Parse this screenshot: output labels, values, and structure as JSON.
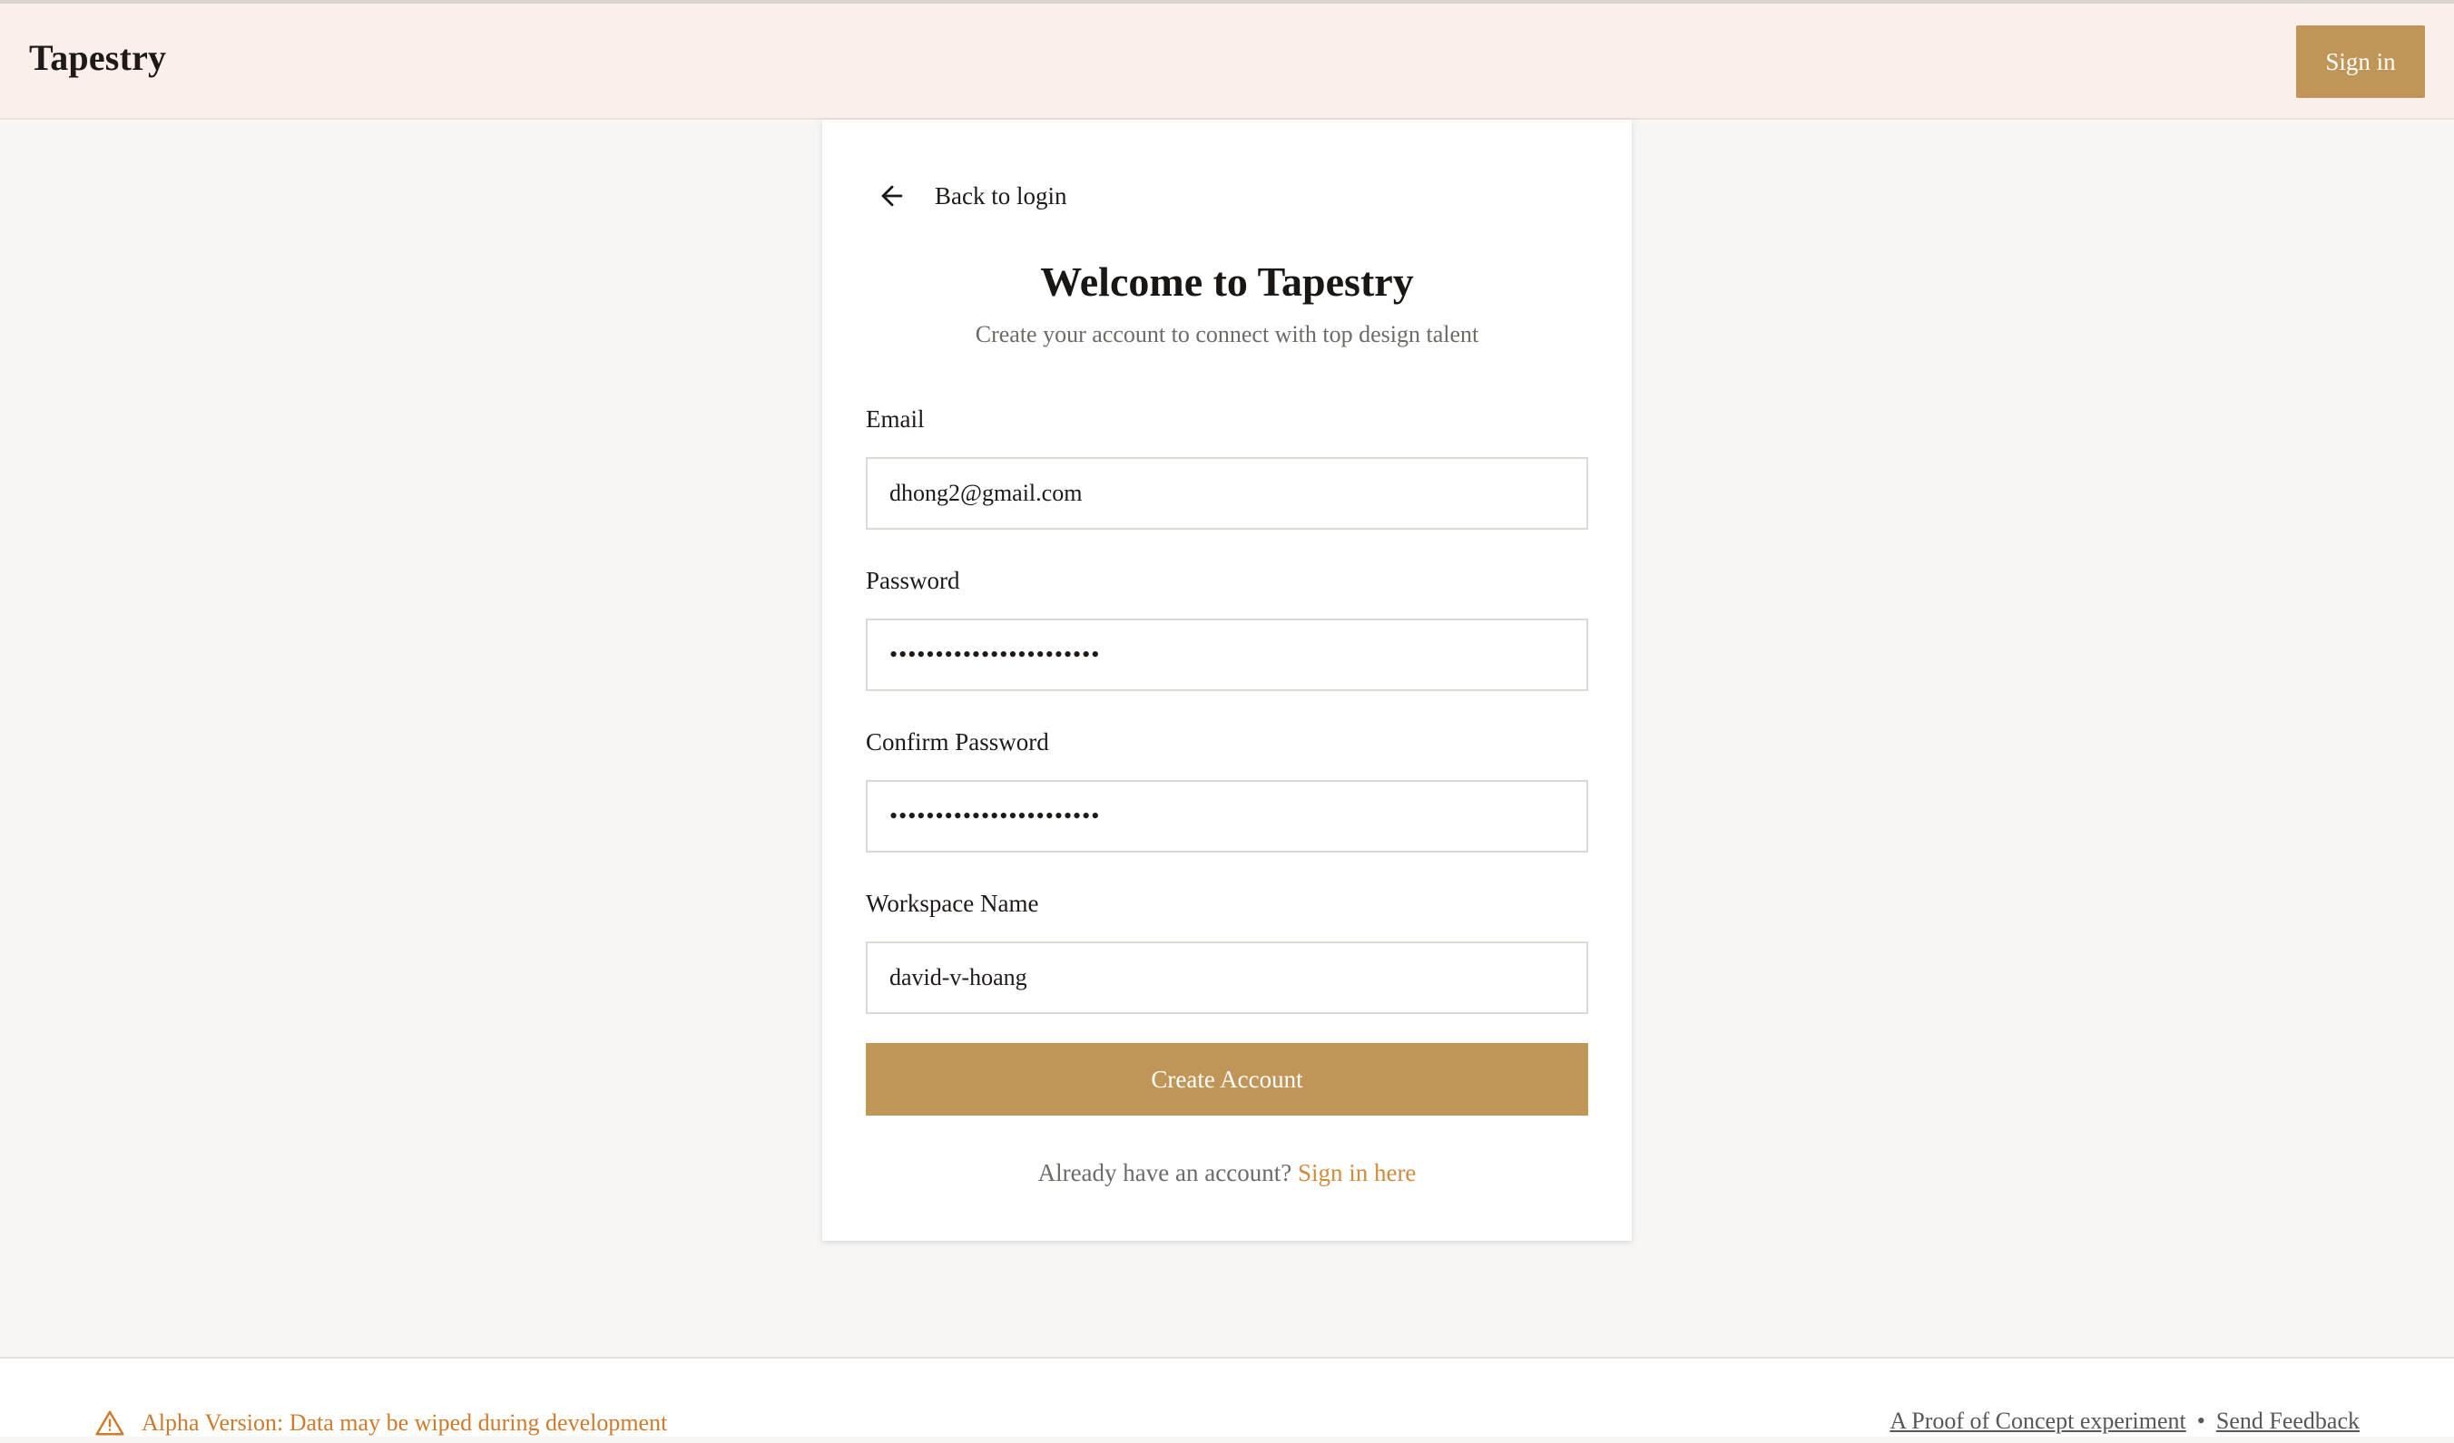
{
  "header": {
    "brand": "Tapestry",
    "signin_label": "Sign in"
  },
  "card": {
    "back_label": "Back to login",
    "title": "Welcome to Tapestry",
    "subtitle": "Create your account to connect with top design talent",
    "fields": {
      "email": {
        "label": "Email",
        "value": "dhong2@gmail.com"
      },
      "password": {
        "label": "Password",
        "value": "•••••••••••••••••••••••"
      },
      "confirm_password": {
        "label": "Confirm Password",
        "value": "•••••••••••••••••••••••"
      },
      "workspace": {
        "label": "Workspace Name",
        "value": "david-v-hoang"
      }
    },
    "create_label": "Create Account",
    "already_text": "Already have an account?",
    "signin_link": "Sign in here"
  },
  "footer": {
    "alpha_text": "Alpha Version: Data may be wiped during development",
    "poc_link": "A Proof of Concept experiment",
    "separator": "•",
    "feedback_link": "Send Feedback"
  },
  "colors": {
    "accent": "#c09658",
    "header_bg": "#fbefeb",
    "page_bg": "#f7f6f4",
    "warning": "#d07a2c",
    "link": "#d08b3e"
  },
  "icons": {
    "back": "arrow-left-icon",
    "alpha": "warning-triangle-icon"
  }
}
